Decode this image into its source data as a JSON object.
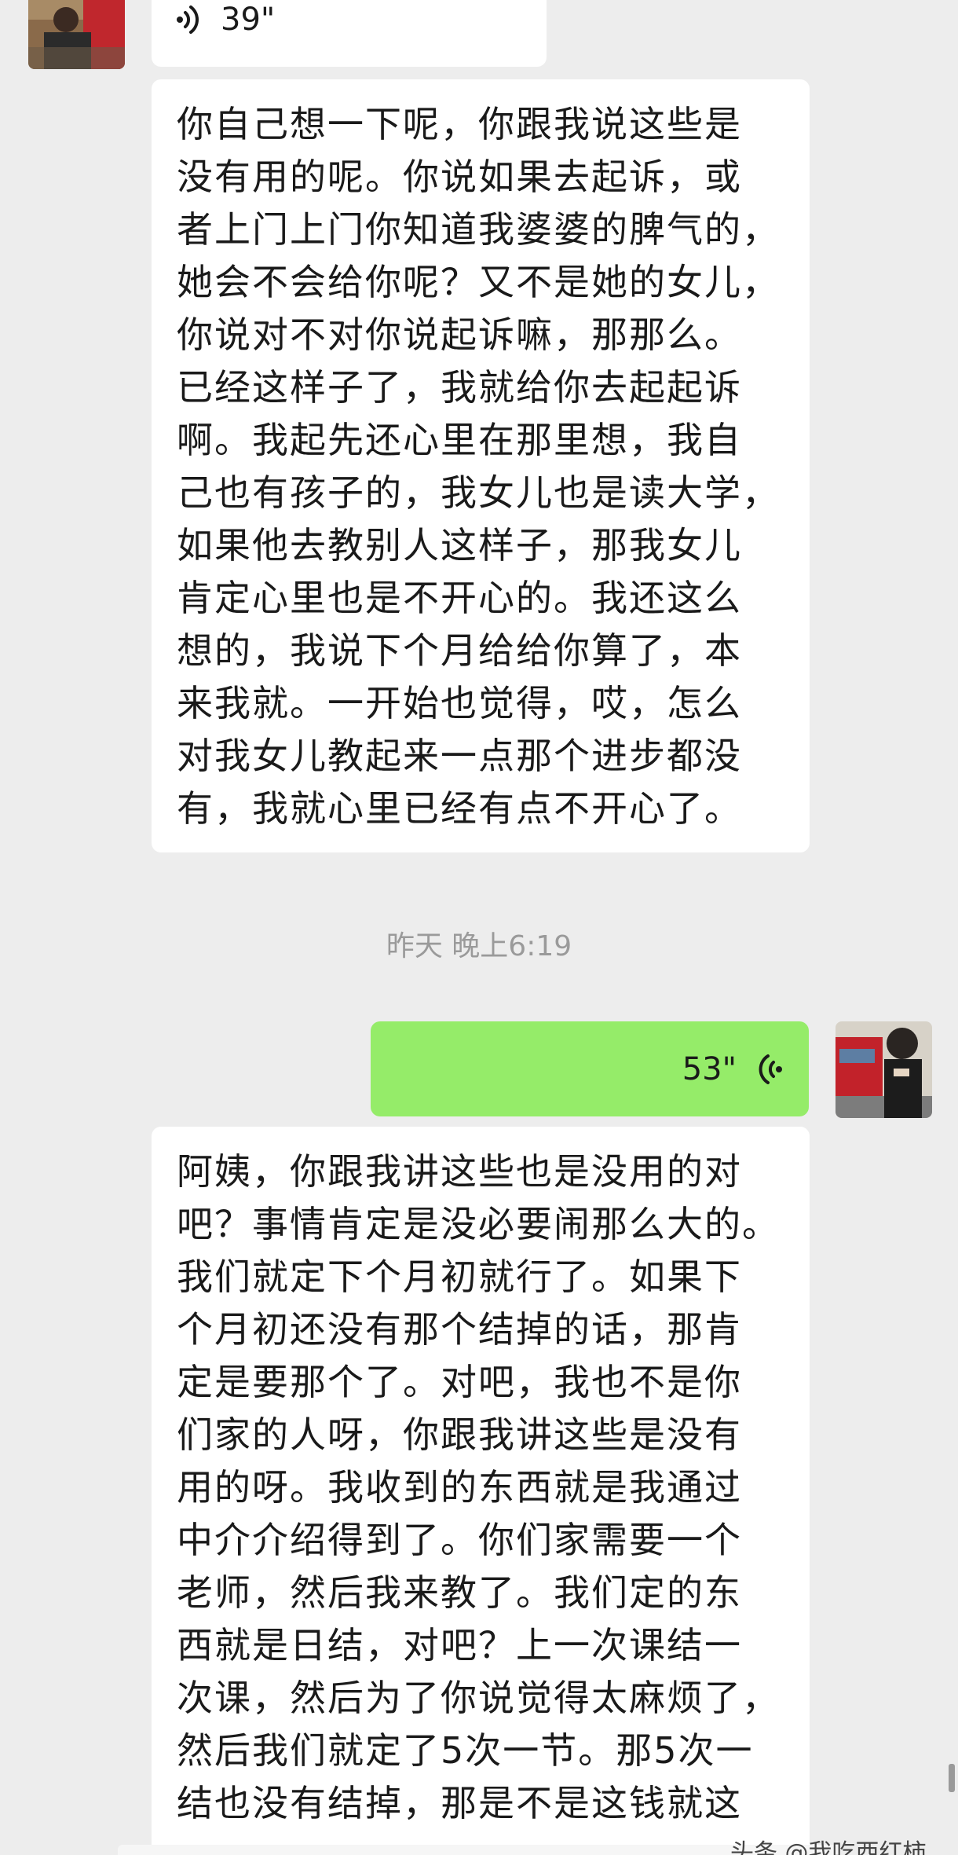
{
  "messages": [
    {
      "id": "voice-1",
      "direction": "incoming",
      "kind": "voice",
      "duration": "39\""
    },
    {
      "id": "text-1",
      "direction": "incoming",
      "kind": "text",
      "text": "你自己想一下呢，你跟我说这些是\n没有用的呢。你说如果去起诉，或\n者上门上门你知道我婆婆的脾气的，\n她会不会给你呢？又不是她的女儿，\n你说对不对你说起诉嘛，那那么。\n已经这样子了，我就给你去起起诉\n啊。我起先还心里在那里想，我自\n己也有孩子的，我女儿也是读大学，\n如果他去教别人这样子，那我女儿\n肯定心里也是不开心的。我还这么\n想的，我说下个月给给你算了，本\n来我就。一开始也觉得，哎，怎么\n对我女儿教起来一点那个进步都没\n有，我就心里已经有点不开心了。"
    },
    {
      "id": "timestamp-1",
      "kind": "timestamp",
      "text": "昨天 晚上6:19"
    },
    {
      "id": "voice-2",
      "direction": "outgoing",
      "kind": "voice",
      "duration": "53\""
    },
    {
      "id": "text-2",
      "direction": "incoming",
      "kind": "text",
      "text": "阿姨，你跟我讲这些也是没用的对\n吧？事情肯定是没必要闹那么大的。\n我们就定下个月初就行了。如果下\n个月初还没有那个结掉的话，那肯\n定是要那个了。对吧，我也不是你\n们家的人呀，你跟我讲这些是没有\n用的呀。我收到的东西就是我通过\n中介介绍得到了。你们家需要一个\n老师，然后我来教了。我们定的东\n西就是日结，对吧？上一次课结一\n次课，然后为了你说觉得太麻烦了，\n然后我们就定了5次一节。那5次一\n结也没有结掉，那是不是这钱就这"
    }
  ],
  "watermark": "头条 @我吃西红柿",
  "icons": {
    "voice_incoming": "voice-wave-icon",
    "voice_outgoing": "voice-wave-icon"
  },
  "colors": {
    "background": "#ededed",
    "incoming_bubble": "#ffffff",
    "outgoing_bubble": "#95ec69",
    "timestamp_text": "#9a9a9a"
  }
}
